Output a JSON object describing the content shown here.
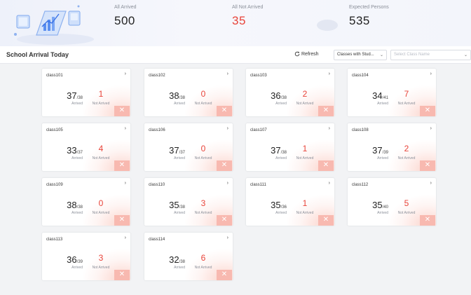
{
  "summary": {
    "all_arrived_label": "All Arrived",
    "all_arrived_value": "500",
    "all_not_arrived_label": "All Not Arrived",
    "all_not_arrived_value": "35",
    "expected_label": "Expected Persons",
    "expected_value": "535"
  },
  "toolbar": {
    "title": "School Arrival Today",
    "refresh_label": "Refresh",
    "filter_select_value": "Classes with Stud...",
    "class_name_placeholder": "Select Class Name"
  },
  "card_labels": {
    "arrived": "Arrived",
    "not_arrived": "Not Arrived"
  },
  "classes": [
    {
      "name": "class101",
      "arrived": "37",
      "total": "38",
      "not_arrived": "1"
    },
    {
      "name": "class102",
      "arrived": "38",
      "total": "38",
      "not_arrived": "0"
    },
    {
      "name": "class103",
      "arrived": "36",
      "total": "38",
      "not_arrived": "2"
    },
    {
      "name": "class104",
      "arrived": "34",
      "total": "41",
      "not_arrived": "7"
    },
    {
      "name": "class105",
      "arrived": "33",
      "total": "37",
      "not_arrived": "4"
    },
    {
      "name": "class106",
      "arrived": "37",
      "total": "37",
      "not_arrived": "0"
    },
    {
      "name": "class107",
      "arrived": "37",
      "total": "38",
      "not_arrived": "1"
    },
    {
      "name": "class108",
      "arrived": "37",
      "total": "39",
      "not_arrived": "2"
    },
    {
      "name": "class109",
      "arrived": "38",
      "total": "38",
      "not_arrived": "0"
    },
    {
      "name": "class110",
      "arrived": "35",
      "total": "38",
      "not_arrived": "3"
    },
    {
      "name": "class111",
      "arrived": "35",
      "total": "36",
      "not_arrived": "1"
    },
    {
      "name": "class112",
      "arrived": "35",
      "total": "40",
      "not_arrived": "5"
    },
    {
      "name": "class113",
      "arrived": "36",
      "total": "39",
      "not_arrived": "3"
    },
    {
      "name": "class114",
      "arrived": "32",
      "total": "38",
      "not_arrived": "6"
    }
  ],
  "icons": {
    "card_arrow": "chevron-right-icon",
    "card_close": "close-icon",
    "refresh": "refresh-icon",
    "dropdown": "chevron-down-icon"
  }
}
